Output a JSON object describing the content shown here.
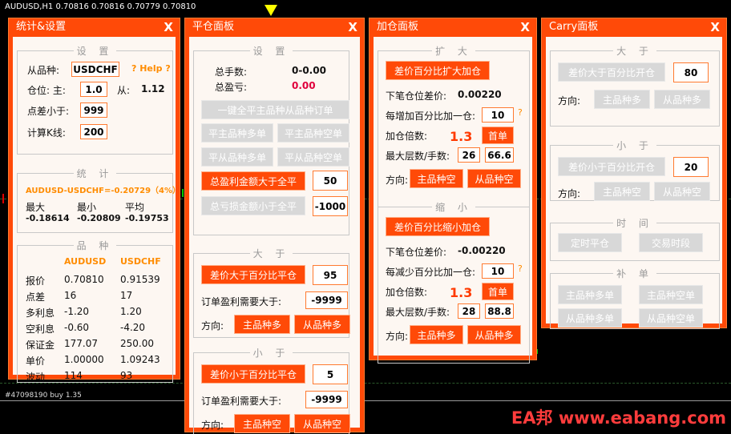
{
  "chart": {
    "symbol_line": "AUDUSD,H1  0.70816 0.70816 0.70779 0.70810",
    "order_label": "#47098190 buy 1.35",
    "watermark": "EA邦 www.eabang.com"
  },
  "stats": {
    "title": "统计&设置",
    "close": "X",
    "settings": {
      "label": "设 置",
      "from_symbol_label": "从品种:",
      "from_symbol_value": "USDCHF",
      "help": "? Help ?",
      "position_label": "仓位: 主:",
      "main_lot": "1.0",
      "slave_label": "从:",
      "slave_lot": "1.12",
      "spread_label": "点差小于:",
      "spread_value": "999",
      "kline_label": "计算K线:",
      "kline_value": "200"
    },
    "statistics": {
      "label": "统 计",
      "pair_line": "AUDUSD-USDCHF=-0.20729（4%）",
      "max_label": "最大",
      "min_label": "最小",
      "avg_label": "平均",
      "max_value": "-0.18614",
      "min_value": "-0.20809",
      "avg_value": "-0.19753"
    },
    "symbols": {
      "label": "品 种",
      "col_main": "AUDUSD",
      "col_slave": "USDCHF",
      "rows": [
        {
          "label": "报价",
          "main": "0.70810",
          "slave": "0.91539"
        },
        {
          "label": "点差",
          "main": "16",
          "slave": "17"
        },
        {
          "label": "多利息",
          "main": "-1.20",
          "slave": "1.20"
        },
        {
          "label": "空利息",
          "main": "-0.60",
          "slave": "-4.20"
        },
        {
          "label": "保证金",
          "main": "177.07",
          "slave": "250.00"
        },
        {
          "label": "单价",
          "main": "1.00000",
          "slave": "1.09243"
        },
        {
          "label": "波动",
          "main": "114",
          "slave": "93"
        }
      ]
    }
  },
  "close_panel": {
    "title": "平仓面板",
    "close": "X",
    "settings": {
      "label": "设 置",
      "total_lots_label": "总手数:",
      "total_lots_value": "0-0.00",
      "total_pl_label": "总盈亏:",
      "total_pl_value": "0.00",
      "btn_close_all": "一键全平主品种从品种订单",
      "btn_close_main_long": "平主品种多单",
      "btn_close_main_short": "平主品种空单",
      "btn_close_slave_long": "平从品种多单",
      "btn_close_slave_short": "平从品种空单",
      "btn_profit_gt": "总盈利金额大于全平",
      "profit_value": "50",
      "btn_loss_lt": "总亏损金额小于全平",
      "loss_value": "-1000"
    },
    "greater": {
      "label": "大 于",
      "btn": "差价大于百分比平仓",
      "value": "95",
      "profit_label": "订单盈利需要大于:",
      "profit_value": "-9999",
      "dir_label": "方向:",
      "btn_main": "主品种多",
      "btn_slave": "从品种多"
    },
    "less": {
      "label": "小 于",
      "btn": "差价小于百分比平仓",
      "value": "5",
      "profit_label": "订单盈利需要大于:",
      "profit_value": "-9999",
      "dir_label": "方向:",
      "btn_main": "主品种空",
      "btn_slave": "从品种空"
    }
  },
  "add_panel": {
    "title": "加仓面板",
    "close": "X",
    "expand": {
      "label": "扩 大",
      "btn": "差价百分比扩大加仓",
      "next_label": "下笔仓位差价:",
      "next_value": "0.00220",
      "each_label": "每增加百分比加一仓:",
      "each_value": "10",
      "q": "?",
      "mult_label": "加仓倍数:",
      "mult_value": "1.3",
      "first_btn": "首单",
      "max_label": "最大层数/手数:",
      "max_layers": "26",
      "max_lots": "66.6",
      "dir_label": "方向:",
      "btn_main": "主品种空",
      "btn_slave": "从品种空"
    },
    "shrink": {
      "label": "缩 小",
      "btn": "差价百分比缩小加仓",
      "next_label": "下笔仓位差价:",
      "next_value": "-0.00220",
      "each_label": "每减少百分比加一仓:",
      "each_value": "10",
      "q": "?",
      "mult_label": "加仓倍数:",
      "mult_value": "1.3",
      "first_btn": "首单",
      "max_label": "最大层数/手数:",
      "max_layers": "28",
      "max_lots": "88.8",
      "dir_label": "方向:",
      "btn_main": "主品种多",
      "btn_slave": "从品种多"
    }
  },
  "carry_panel": {
    "title": "Carry面板",
    "close": "X",
    "greater": {
      "label": "大 于",
      "btn": "差价大于百分比开仓",
      "value": "80",
      "dir_label": "方向:",
      "btn_main": "主品种多",
      "btn_slave": "从品种多"
    },
    "less": {
      "label": "小 于",
      "btn": "差价小于百分比开仓",
      "value": "20",
      "dir_label": "方向:",
      "btn_main": "主品种空",
      "btn_slave": "从品种空"
    },
    "time": {
      "label": "时 间",
      "btn_timed": "定时平仓",
      "btn_session": "交易时段"
    },
    "supplement": {
      "label": "补 单",
      "btn_main_long": "主品种多单",
      "btn_main_short": "主品种空单",
      "btn_slave_long": "从品种多单",
      "btn_slave_short": "从品种空单"
    }
  }
}
